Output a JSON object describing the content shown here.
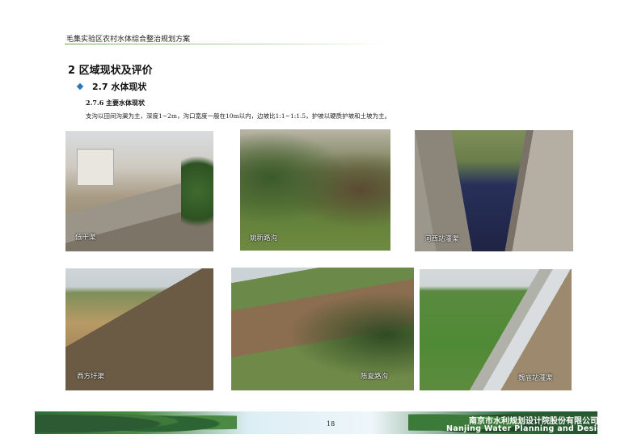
{
  "header": {
    "title": "毛集实验区农村水体综合整治规划方案"
  },
  "section": {
    "heading": "2 区域现状及评价"
  },
  "subsection": {
    "title": "2.7 水体现状"
  },
  "subsubsection": {
    "title": "2.7.6 主要水体现状"
  },
  "body": {
    "text": "支沟以田间沟渠为主，深度1~2m，沟口宽度一般在10m以内，边坡比1:1~1:1.5，护坡以硬质护坡和土坡为主。"
  },
  "photos": [
    {
      "caption": "低干渠"
    },
    {
      "caption": "姚新路沟"
    },
    {
      "caption": "河西站灌渠"
    },
    {
      "caption": "西方圩渠"
    },
    {
      "caption": "陈夏路沟"
    },
    {
      "caption": "魏庙站灌渠"
    }
  ],
  "footer": {
    "page_number": "18",
    "company_cn": "南京市水利规划设计院股份有限公司",
    "company_en": "Nanjing Water Planning and Designing"
  }
}
